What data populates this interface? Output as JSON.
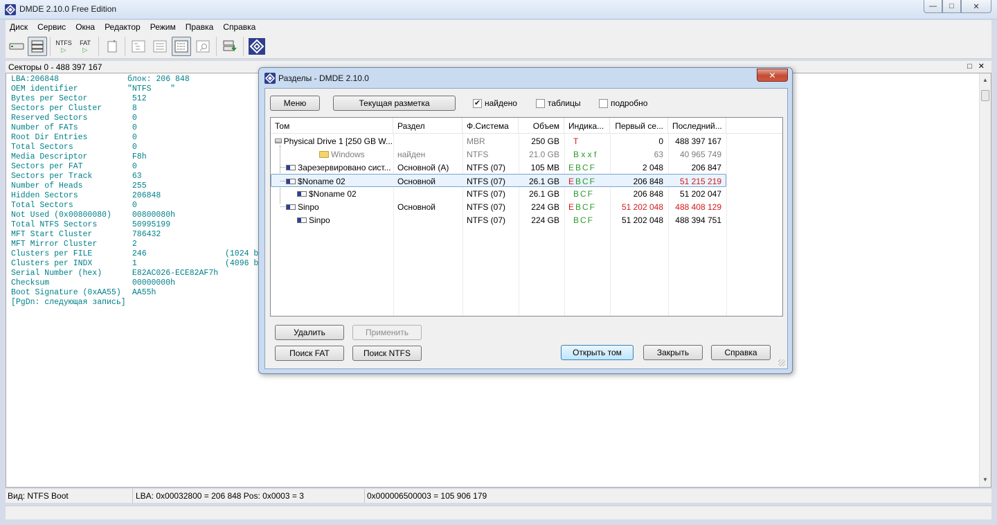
{
  "app": {
    "title": "DMDE 2.10.0 Free Edition",
    "window_buttons": {
      "minimize": "—",
      "maximize": "□",
      "close": "✕"
    }
  },
  "menu": [
    "Диск",
    "Сервис",
    "Окна",
    "Редактор",
    "Режим",
    "Правка",
    "Справка"
  ],
  "toolbar": {
    "ntfs_label": "NTFS",
    "fat_label": "FAT",
    "icons": [
      "drive-icon",
      "partitions-icon",
      "ntfs-search-icon",
      "fat-search-icon",
      "open-file-icon",
      "view-tree-icon",
      "view-list-icon",
      "view-hex-icon",
      "view-find-icon",
      "export-icon",
      "dmde-logo-icon"
    ]
  },
  "sectors_header": "Секторы 0 - 488 397 167",
  "sector_header_controls": {
    "restore": "□",
    "close": "✕"
  },
  "boot_sector": [
    {
      "k": "LBA:206848",
      "v": "блок: 206 848",
      "x": ""
    },
    {
      "k": "OEM identifier",
      "v": "\"NTFS    \"",
      "x": ""
    },
    {
      "k": "Bytes per Sector",
      "v": " 512",
      "x": ""
    },
    {
      "k": "Sectors per Cluster",
      "v": " 8",
      "x": ""
    },
    {
      "k": "Reserved Sectors",
      "v": " 0",
      "x": ""
    },
    {
      "k": "Number of FATs",
      "v": " 0",
      "x": ""
    },
    {
      "k": "Root Dir Entries",
      "v": " 0",
      "x": ""
    },
    {
      "k": "Total Sectors",
      "v": " 0",
      "x": ""
    },
    {
      "k": "Media Descriptor",
      "v": " F8h",
      "x": ""
    },
    {
      "k": "Sectors per FAT",
      "v": " 0",
      "x": ""
    },
    {
      "k": "Sectors per Track",
      "v": " 63",
      "x": ""
    },
    {
      "k": "Number of Heads",
      "v": " 255",
      "x": ""
    },
    {
      "k": "Hidden Sectors",
      "v": " 206848",
      "x": ""
    },
    {
      "k": "Total Sectors",
      "v": " 0",
      "x": ""
    },
    {
      "k": "Not Used (0x00800080)",
      "v": " 00800080h",
      "x": ""
    },
    {
      "k": "Total NTFS Sectors",
      "v": " 50995199",
      "x": ""
    },
    {
      "k": "MFT Start Cluster",
      "v": " 786432",
      "x": ""
    },
    {
      "k": "MFT Mirror Cluster",
      "v": " 2",
      "x": ""
    },
    {
      "k": "Clusters per FILE",
      "v": " 246",
      "x": "(1024 b"
    },
    {
      "k": "Clusters per INDX",
      "v": " 1",
      "x": "(4096 b"
    },
    {
      "k": "Serial Number (hex)",
      "v": " E82AC026-ECE82AF7h",
      "x": ""
    },
    {
      "k": "Checksum",
      "v": " 00000000h",
      "x": ""
    },
    {
      "k": "Boot Signature (0xAA55)",
      "v": " AA55h",
      "x": ""
    },
    {
      "k": "[PgDn: следующая запись]",
      "v": "",
      "x": ""
    }
  ],
  "status": {
    "view": "Вид: NTFS Boot",
    "lba": "LBA: 0x00032800 = 206 848  Pos: 0x0003 = 3",
    "offset": "0x000006500003 = 105 906 179"
  },
  "dialog": {
    "title": "Разделы - DMDE 2.10.0",
    "close": "✕",
    "menu_btn": "Меню",
    "layout_btn": "Текущая разметка",
    "checkboxes": [
      {
        "label": "найдено",
        "checked": true,
        "mark": "✔"
      },
      {
        "label": "таблицы",
        "checked": false,
        "mark": ""
      },
      {
        "label": "подробно",
        "checked": false,
        "mark": ""
      }
    ],
    "columns": [
      "Том",
      "Раздел",
      "Ф.Система",
      "Объем",
      "Индика...",
      "Первый се...",
      "Последний..."
    ],
    "rows": [
      {
        "name": "Physical Drive 1 [250 GB W...",
        "part": "",
        "fs": "MBR",
        "size": "250 GB",
        "ind": "T",
        "first": "0",
        "last": "488 397 167",
        "style": "drive"
      },
      {
        "name": "Windows",
        "part": "найден",
        "fs": "NTFS",
        "size": "21.0 GB",
        "ind": "B x x f",
        "first": "63",
        "last": "40 965 749",
        "style": "found"
      },
      {
        "name": "Зарезервировано сист...",
        "part": "Основной (A)",
        "fs": "NTFS (07)",
        "size": "105 MB",
        "ind": "EBCF",
        "first": "2 048",
        "last": "206 847",
        "style": "vol"
      },
      {
        "name": "$Noname 02",
        "part": "Основной",
        "fs": "NTFS (07)",
        "size": "26.1 GB",
        "ind_e": "E",
        "ind": "BCF",
        "first": "206 848",
        "last": "51 215 219",
        "style": "sel"
      },
      {
        "name": "$Noname 02",
        "part": "",
        "fs": "NTFS (07)",
        "size": "26.1 GB",
        "ind": "BCF",
        "first": "206 848",
        "last": "51 202 047",
        "style": "sub"
      },
      {
        "name": "Sinpo",
        "part": "Основной",
        "fs": "NTFS (07)",
        "size": "224 GB",
        "ind_e": "E",
        "ind": "BCF",
        "first": "51 202 048",
        "last": "488 408 129",
        "style": "red"
      },
      {
        "name": "Sinpo",
        "part": "",
        "fs": "NTFS (07)",
        "size": "224 GB",
        "ind": "BCF",
        "first": "51 202 048",
        "last": "488 394 751",
        "style": "sub"
      }
    ],
    "buttons": {
      "delete": "Удалить",
      "apply": "Применить",
      "search_fat": "Поиск FAT",
      "search_ntfs": "Поиск NTFS",
      "open_volume": "Открыть том",
      "close": "Закрыть",
      "help": "Справка"
    }
  }
}
